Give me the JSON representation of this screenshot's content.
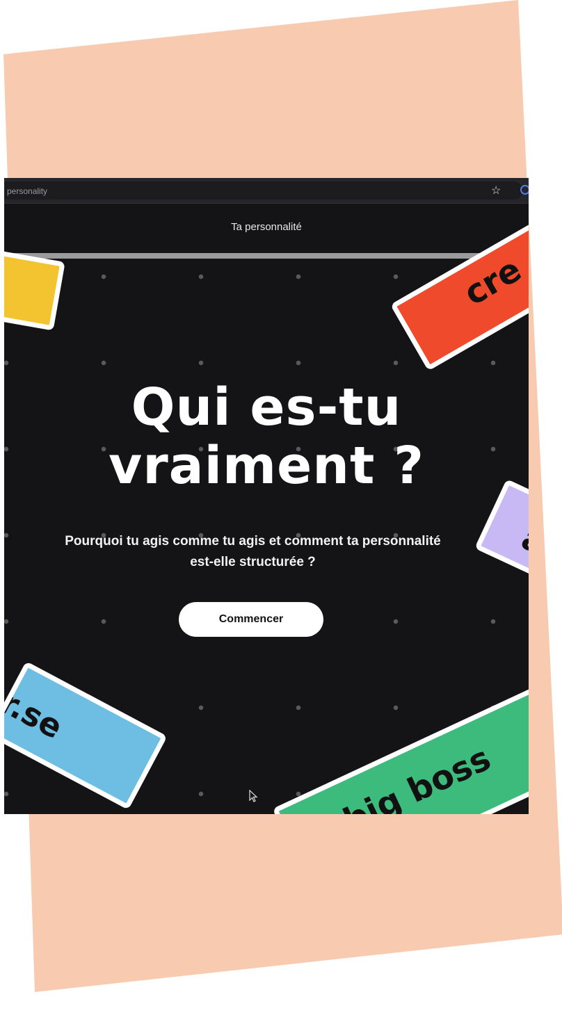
{
  "browser": {
    "url_fragment": "personality"
  },
  "app": {
    "title": "Ta personnalité",
    "progress": 1.0
  },
  "hero": {
    "heading_line1": "Qui es-tu",
    "heading_line2": "vraiment ?",
    "subtitle_line1": "Pourquoi tu agis comme tu agis et comment ta personnalité",
    "subtitle_line2": "est-elle structurée ?",
    "cta_label": "Commencer"
  },
  "tags": [
    {
      "label": "",
      "color": "#f4c430"
    },
    {
      "label": "cre",
      "color": "#ef4a2c"
    },
    {
      "label": "a",
      "color": "#c8b9f5"
    },
    {
      "label": "r.se",
      "color": "#6ebde3"
    },
    {
      "label": "big boss",
      "color": "#3dbb7d"
    }
  ],
  "icons": {
    "bookmark": "star-icon",
    "extension": "extension-icon",
    "pointer": "cursor-icon"
  }
}
